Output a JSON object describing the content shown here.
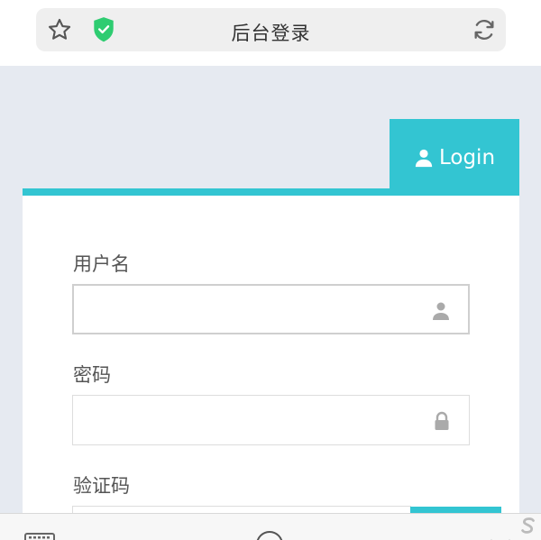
{
  "browser": {
    "title": "后台登录",
    "icons": [
      "star-icon",
      "shield-check-icon",
      "refresh-icon"
    ]
  },
  "login": {
    "tab_label": "Login",
    "username_label": "用户名",
    "username_value": "",
    "password_label": "密码",
    "password_value": "",
    "captcha_label": "验证码",
    "captcha_value": ""
  },
  "colors": {
    "accent": "#33c5d2",
    "background": "#e6eaf1",
    "shield": "#2ecc71"
  }
}
